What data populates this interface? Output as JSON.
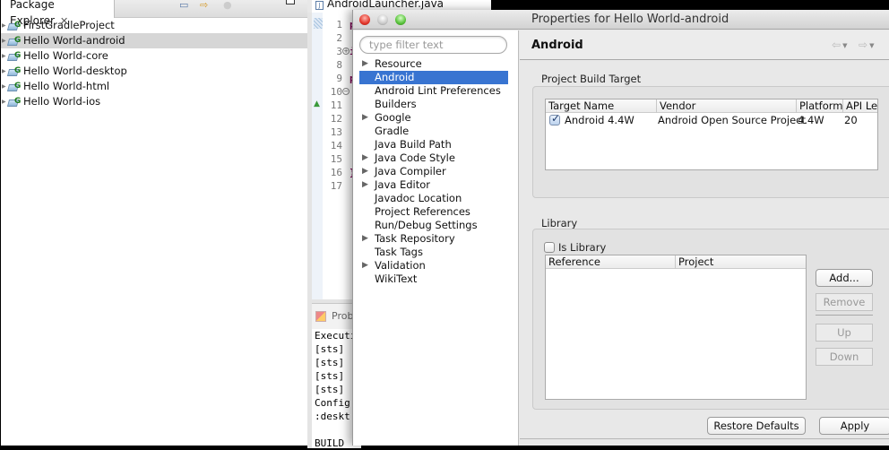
{
  "package_explorer": {
    "tab_label": "Package Explorer",
    "projects": [
      {
        "name": "FirstGradleProject",
        "selected": false
      },
      {
        "name": "Hello World-android",
        "selected": true
      },
      {
        "name": "Hello World-core",
        "selected": false
      },
      {
        "name": "Hello World-desktop",
        "selected": false
      },
      {
        "name": "Hello World-html",
        "selected": false
      },
      {
        "name": "Hello World-ios",
        "selected": false
      }
    ]
  },
  "editor": {
    "tab_label": "AndroidLauncher.java",
    "line_numbers": [
      "1",
      "2",
      "3",
      "8",
      "9",
      "10",
      "11",
      "12",
      "13",
      "14",
      "15",
      "16",
      "17"
    ],
    "code_fragments": {
      "1": "p",
      "3": "i",
      "9": "p",
      "16": "}"
    },
    "console": {
      "tab_label": "Prob",
      "lines": [
        "Executin",
        "[sts]",
        "[sts]",
        "[sts]",
        "[sts]",
        "Config",
        ":deskt",
        "",
        "BUILD"
      ]
    }
  },
  "dialog": {
    "title": "Properties for Hello World-android",
    "filter_placeholder": "type filter text",
    "categories": [
      {
        "label": "Resource",
        "expandable": true
      },
      {
        "label": "Android",
        "expandable": false,
        "selected": true
      },
      {
        "label": "Android Lint Preferences",
        "expandable": false
      },
      {
        "label": "Builders",
        "expandable": false
      },
      {
        "label": "Google",
        "expandable": true
      },
      {
        "label": "Gradle",
        "expandable": false
      },
      {
        "label": "Java Build Path",
        "expandable": false
      },
      {
        "label": "Java Code Style",
        "expandable": true
      },
      {
        "label": "Java Compiler",
        "expandable": true
      },
      {
        "label": "Java Editor",
        "expandable": true
      },
      {
        "label": "Javadoc Location",
        "expandable": false
      },
      {
        "label": "Project References",
        "expandable": false
      },
      {
        "label": "Run/Debug Settings",
        "expandable": false
      },
      {
        "label": "Task Repository",
        "expandable": true
      },
      {
        "label": "Task Tags",
        "expandable": false
      },
      {
        "label": "Validation",
        "expandable": true
      },
      {
        "label": "WikiText",
        "expandable": false
      }
    ],
    "page_title": "Android",
    "build_target": {
      "label": "Project Build Target",
      "columns": [
        "Target Name",
        "Vendor",
        "Platform",
        "API Le"
      ],
      "rows": [
        {
          "checked": true,
          "target_name": "Android 4.4W",
          "vendor": "Android Open Source Project",
          "platform": "4.4W",
          "api_level": "20"
        }
      ]
    },
    "library": {
      "label": "Library",
      "is_library_label": "Is Library",
      "is_library_checked": false,
      "columns": [
        "Reference",
        "Project"
      ],
      "buttons": {
        "add": "Add...",
        "remove": "Remove",
        "up": "Up",
        "down": "Down"
      }
    },
    "footer": {
      "restore_defaults": "Restore Defaults",
      "apply": "Apply"
    }
  }
}
